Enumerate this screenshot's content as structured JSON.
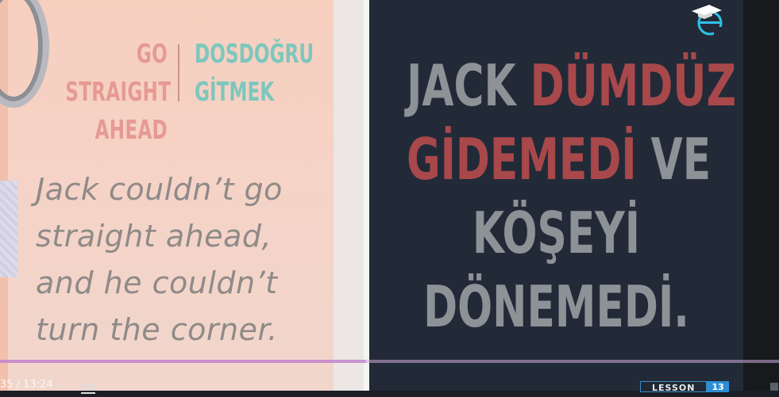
{
  "left_card": {
    "phrase_en_lines": [
      "GO STRAIGHT",
      "AHEAD"
    ],
    "phrase_tr_lines": [
      "DOSDOĞRU",
      "GİTMEK"
    ],
    "example_lines": [
      "Jack couldn’t go",
      "straight ahead,",
      "and he couldn’t",
      "turn the corner."
    ]
  },
  "right_card": {
    "line1": {
      "a": "JACK ",
      "b": "DÜMDÜZ"
    },
    "line2": {
      "a": "GİDEMEDİ",
      "b": " VE"
    },
    "line3": "KÖŞEYİ",
    "line4": "DÖNEMEDİ."
  },
  "player": {
    "time_text": "35 / 13:24",
    "progress": 0.47,
    "lesson_label": "LESSON",
    "lesson_number": "13"
  },
  "colors": {
    "phrase_en": "#e69a93",
    "phrase_tr": "#7cc7bd",
    "highlight": "#a8484b",
    "right_bg": "#222a38"
  },
  "icons": {
    "logo": "e-graduation-cap-logo",
    "menu": "menu-icon"
  }
}
